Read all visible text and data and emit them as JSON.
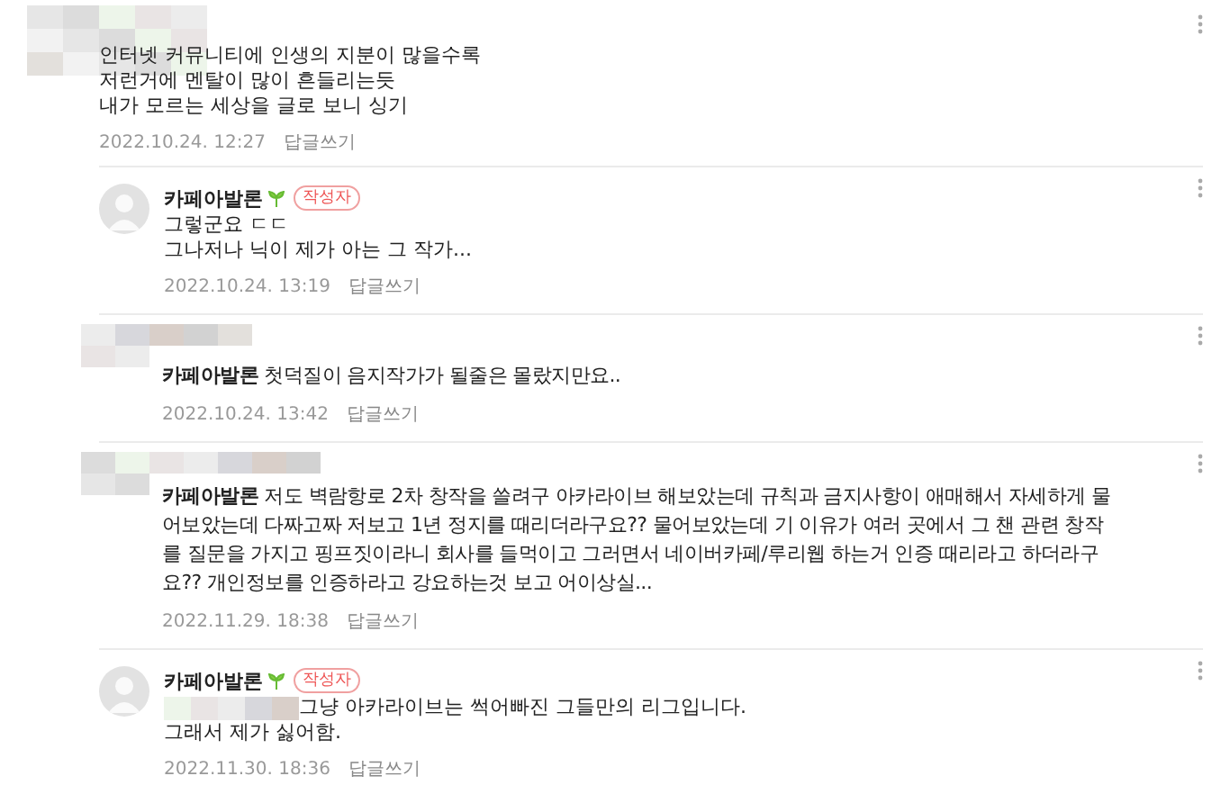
{
  "comments": [
    {
      "kind": "top",
      "profile_photo": false,
      "lines": [
        "인터넷 커뮤니티에 인생의 지분이 많을수록",
        "저런거에 멘탈이 많이 흔들리는듯",
        "내가 모르는 세상을 글로 보니 싱기"
      ],
      "date": "2022.10.24. 12:27",
      "reply": "답글쓰기"
    },
    {
      "kind": "block",
      "profile_photo": true,
      "name": "카페아발론",
      "leaf": true,
      "badge": "작성자",
      "lines": [
        "그렇군요 ㄷㄷ",
        "그나저나 닉이 제가 아는 그 작가..."
      ],
      "date": "2022.10.24. 13:19",
      "reply": "답글쓰기"
    },
    {
      "kind": "inline",
      "profile_photo": false,
      "name": "카페아발론",
      "lines": [
        "첫덕질이 음지작가가 될줄은 몰랐지만요.."
      ],
      "date": "2022.10.24. 13:42",
      "reply": "답글쓰기"
    },
    {
      "kind": "inline",
      "profile_photo": false,
      "name": "카페아발론",
      "lines": [
        "저도 벽람항로 2차 창작을 쓸려구 아카라이브 해보았는데 규칙과 금지사항이 애매해서 자세하게 물어보았는데 다짜고짜 저보고 1년 정지를 때리더라구요?? 물어보았는데 기 이유가 여러 곳에서 그 챈 관련 창작를 질문을 가지고 핑프짓이라니 회사를 들먹이고 그러면서 네이버카페/루리웹 하는거 인증 때리라고 하더라구요?? 개인정보를 인증하라고 강요하는것 보고 어이상실..."
      ],
      "date": "2022.11.29. 18:38",
      "reply": "답글쓰기"
    },
    {
      "kind": "block",
      "profile_photo": true,
      "name": "카페아발론",
      "leaf": true,
      "badge": "작성자",
      "mosaic_prefix": true,
      "lines": [
        "그냥 아카라이브는 썩어빠진 그들만의 리그입니다.",
        "그래서 제가 싫어함."
      ],
      "date": "2022.11.30. 18:36",
      "reply": "답글쓰기"
    }
  ]
}
